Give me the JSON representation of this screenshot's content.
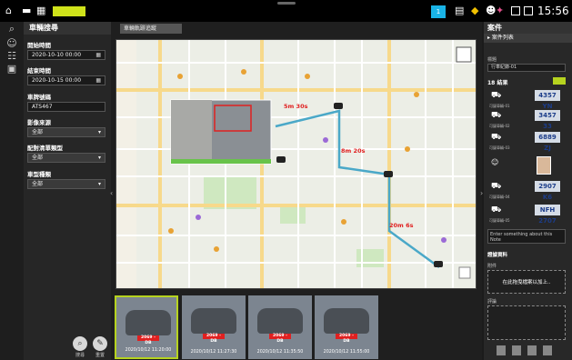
{
  "topbar": {
    "tag_label": "",
    "badge_count": "1",
    "clock": "15:56"
  },
  "left": {
    "panel_title": "車輛搜尋",
    "start_label": "開始時間",
    "start_value": "2020-10-10 00:00",
    "end_label": "結束時間",
    "end_value": "2020-10-15 00:00",
    "plate_label": "車牌號碼",
    "plate_value": "ATS467",
    "source_label": "影像來源",
    "source_value": "全部",
    "type_label": "配對清單類型",
    "type_value": "全部",
    "vehicle_label": "車型種類",
    "vehicle_value": "全部",
    "search_btn": "搜尋",
    "clear_btn": "重置"
  },
  "center": {
    "map_tab": "車輛軌跡追蹤",
    "route_times": [
      "5m 30s",
      "8m 20s",
      "20m 6s"
    ],
    "thumbnails": [
      {
        "plate": "2069 - DB",
        "time": "2020/10/12 11:20:00"
      },
      {
        "plate": "2069 - DB",
        "time": "2020/10/12 11:27:30"
      },
      {
        "plate": "2069 - DB",
        "time": "2020/10/12 11:35:50"
      },
      {
        "plate": "2069 - DB",
        "time": "2020/10/12 11:55:00"
      }
    ]
  },
  "right": {
    "title": "案件",
    "subtitle": "案件列表",
    "label": "標題",
    "input_value": "行車紀錄-01",
    "results": "18 結果",
    "rows": [
      {
        "label": "可疑車輛-01",
        "plate": "4357 YN"
      },
      {
        "label": "可疑車輛-02",
        "plate": "3457 33"
      },
      {
        "label": "可疑車輛-03",
        "plate": "6889 ZJ"
      },
      {
        "label": "可疑車輛-04",
        "plate": "2907 K6"
      },
      {
        "label": "可疑車輛-05",
        "plate": "NFH 2707"
      }
    ],
    "note_placeholder": "Enter something about this Note",
    "section_label": "證據資料",
    "box1_label": "附件",
    "box1_text": "在此拖曳檔案以加上..",
    "box2_label": "評論"
  }
}
